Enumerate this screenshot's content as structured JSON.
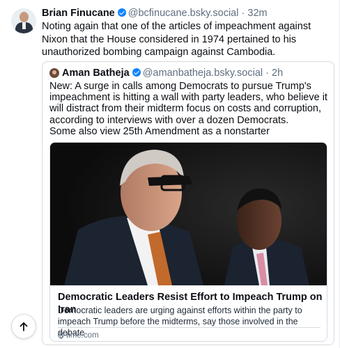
{
  "post": {
    "author_name": "Brian Finucane",
    "handle": "@bcfinucane.bsky.social",
    "separator": "·",
    "time": "32m",
    "text": "Noting again that one of the articles of impeachment against Nixon that the House considered in 1974 pertained to his unauthorized bombing campaign against Cambodia."
  },
  "quote": {
    "author_name": "Aman Batheja",
    "handle": "@amanbatheja.bsky.social",
    "separator": "·",
    "time": "2h",
    "text_line1": "New: A surge in calls among Democrats to pursue Trump's impeachment is hitting a wall with party leaders, who believe it will distract from their midterm focus on costs and corruption, according to interviews with over a dozen Democrats.",
    "text_line2": "Some also view 25th Amendment as a nonstarter"
  },
  "link_card": {
    "title": "Democratic Leaders Resist Effort to Impeach Trump on Iran",
    "description": "Democratic leaders are urging against efforts within the party to impeach Trump before the midterms, say those involved in the debate",
    "domain": "time.com"
  },
  "colors": {
    "verified": "#1083fe",
    "muted_text": "#5f6f80",
    "border": "#d4dbe2"
  },
  "icons": {
    "verified": "verified-badge-icon",
    "globe": "globe-icon",
    "scroll_top": "arrow-up-icon"
  }
}
